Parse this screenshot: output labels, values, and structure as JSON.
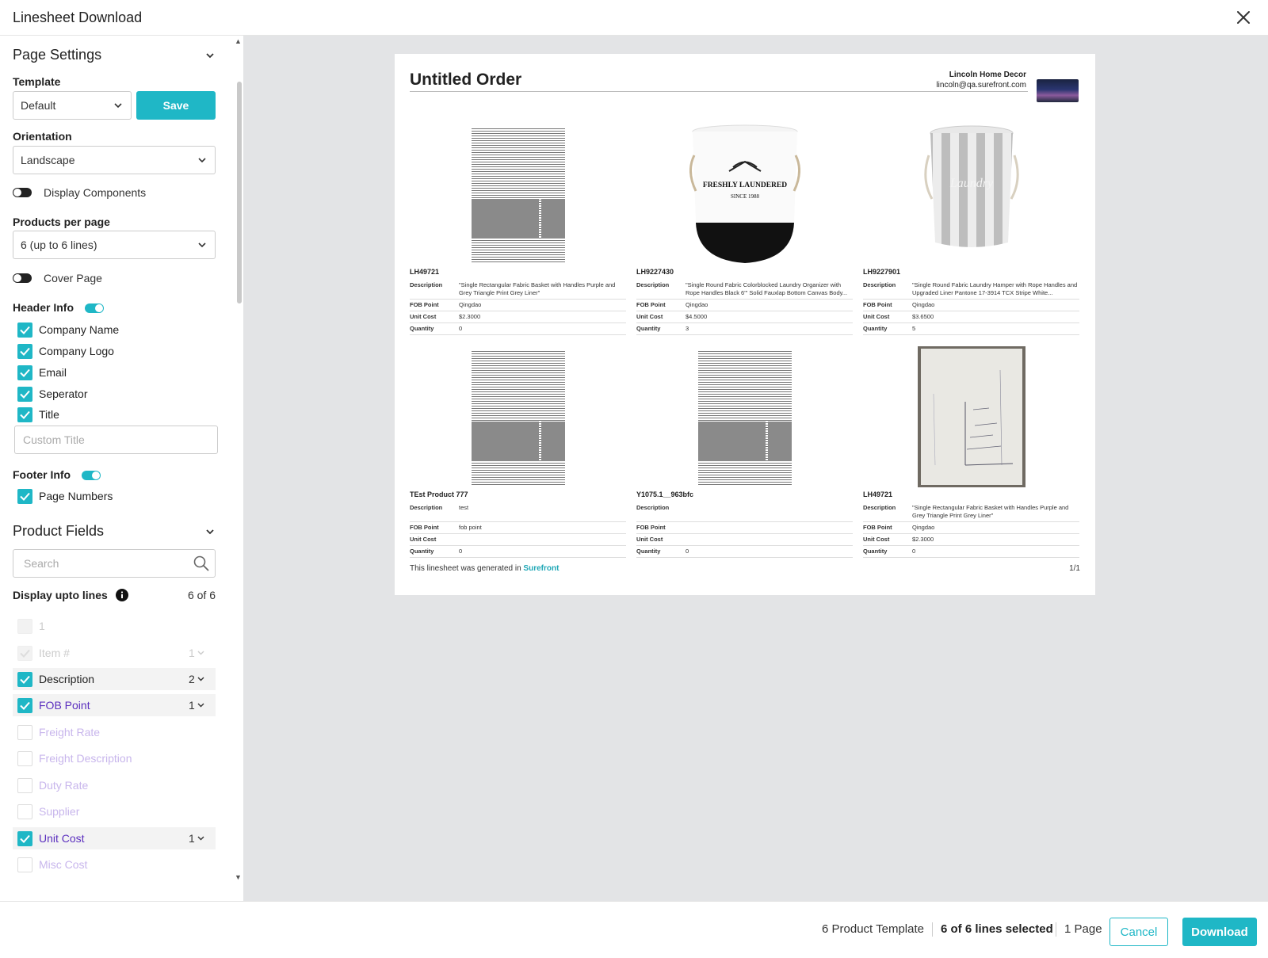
{
  "window": {
    "title": "Linesheet Download"
  },
  "sidebar": {
    "page_settings": {
      "heading": "Page Settings",
      "template_label": "Template",
      "template_value": "Default",
      "save_label": "Save",
      "orientation_label": "Orientation",
      "orientation_value": "Landscape",
      "display_components_label": "Display Components",
      "products_per_page_label": "Products per page",
      "products_per_page_value": "6 (up to 6 lines)",
      "cover_page_label": "Cover Page",
      "header_info_label": "Header Info",
      "header_items": [
        "Company Name",
        "Company Logo",
        "Email",
        "Seperator",
        "Title"
      ],
      "custom_title_placeholder": "Custom Title",
      "footer_info_label": "Footer Info",
      "footer_items": [
        "Page Numbers"
      ]
    },
    "product_fields": {
      "heading": "Product Fields",
      "search_placeholder": "Search",
      "display_lines_label": "Display upto lines",
      "display_lines_count": "6 of 6",
      "fields": [
        {
          "name": "1",
          "checked": false,
          "state": "disabled",
          "lines": ""
        },
        {
          "name": "Item #",
          "checked": true,
          "state": "disabled",
          "lines": "1"
        },
        {
          "name": "Description",
          "checked": true,
          "state": "selected",
          "lines": "2"
        },
        {
          "name": "FOB Point",
          "checked": true,
          "state": "selected-purple",
          "lines": "1"
        },
        {
          "name": "Freight Rate",
          "checked": false,
          "state": "faded",
          "lines": ""
        },
        {
          "name": "Freight Description",
          "checked": false,
          "state": "faded",
          "lines": ""
        },
        {
          "name": "Duty Rate",
          "checked": false,
          "state": "faded",
          "lines": ""
        },
        {
          "name": "Supplier",
          "checked": false,
          "state": "faded",
          "lines": ""
        },
        {
          "name": "Unit Cost",
          "checked": true,
          "state": "selected-purple",
          "lines": "1"
        },
        {
          "name": "Misc Cost",
          "checked": false,
          "state": "faded",
          "lines": ""
        }
      ]
    }
  },
  "preview": {
    "title": "Untitled Order",
    "company_name": "Lincoln Home Decor",
    "company_email": "lincoln@qa.surefront.com",
    "field_labels": {
      "description": "Description",
      "fob": "FOB Point",
      "unit_cost": "Unit Cost",
      "quantity": "Quantity"
    },
    "products": [
      {
        "sku": "LH49721",
        "description": "\"Single Rectangular Fabric Basket with Handles Purple and Grey Triangle Print Grey Liner\"",
        "fob": "Qingdao",
        "unit_cost": "$2.3000",
        "quantity": "0",
        "image": "doc"
      },
      {
        "sku": "LH9227430",
        "description": "\"Single Round Fabric Colorblocked Laundry Organizer with Rope Handles Black 6\"' Solid Fauxlap Bottom Canvas Body...",
        "fob": "Qingdao",
        "unit_cost": "$4.5000",
        "quantity": "3",
        "image": "hamper-bw"
      },
      {
        "sku": "LH9227901",
        "description": "\"Single Round Fabric Laundry Hamper with Rope Handles and Upgraded Liner Pantone 17-3914 TCX Stripe White...",
        "fob": "Qingdao",
        "unit_cost": "$3.6500",
        "quantity": "5",
        "image": "hamper-stripe"
      },
      {
        "sku": "TEst Product 777",
        "description": "test",
        "fob": "fob point",
        "unit_cost": "",
        "quantity": "0",
        "image": "doc"
      },
      {
        "sku": "Y1075.1__963bfc",
        "description": "",
        "fob": "",
        "unit_cost": "",
        "quantity": "0",
        "image": "doc"
      },
      {
        "sku": "LH49721",
        "description": "\"Single Rectangular Fabric Basket with Handles Purple and Grey Triangle Print Grey Liner\"",
        "fob": "Qingdao",
        "unit_cost": "$2.3000",
        "quantity": "0",
        "image": "sketch"
      }
    ],
    "hamper_text": [
      "FRESHLY LAUNDERED",
      "SINCE 1988",
      "Laundry"
    ],
    "footer_text": "This linesheet was generated in",
    "footer_link": "Surefront",
    "page_number": "1/1"
  },
  "bottom_bar": {
    "template_info": "6 Product Template",
    "lines_selected": "6 of 6 lines selected",
    "pages": "1 Page",
    "cancel_label": "Cancel",
    "download_label": "Download"
  },
  "colors": {
    "accent": "#1fb7c6",
    "purple": "#5b2fbf"
  }
}
